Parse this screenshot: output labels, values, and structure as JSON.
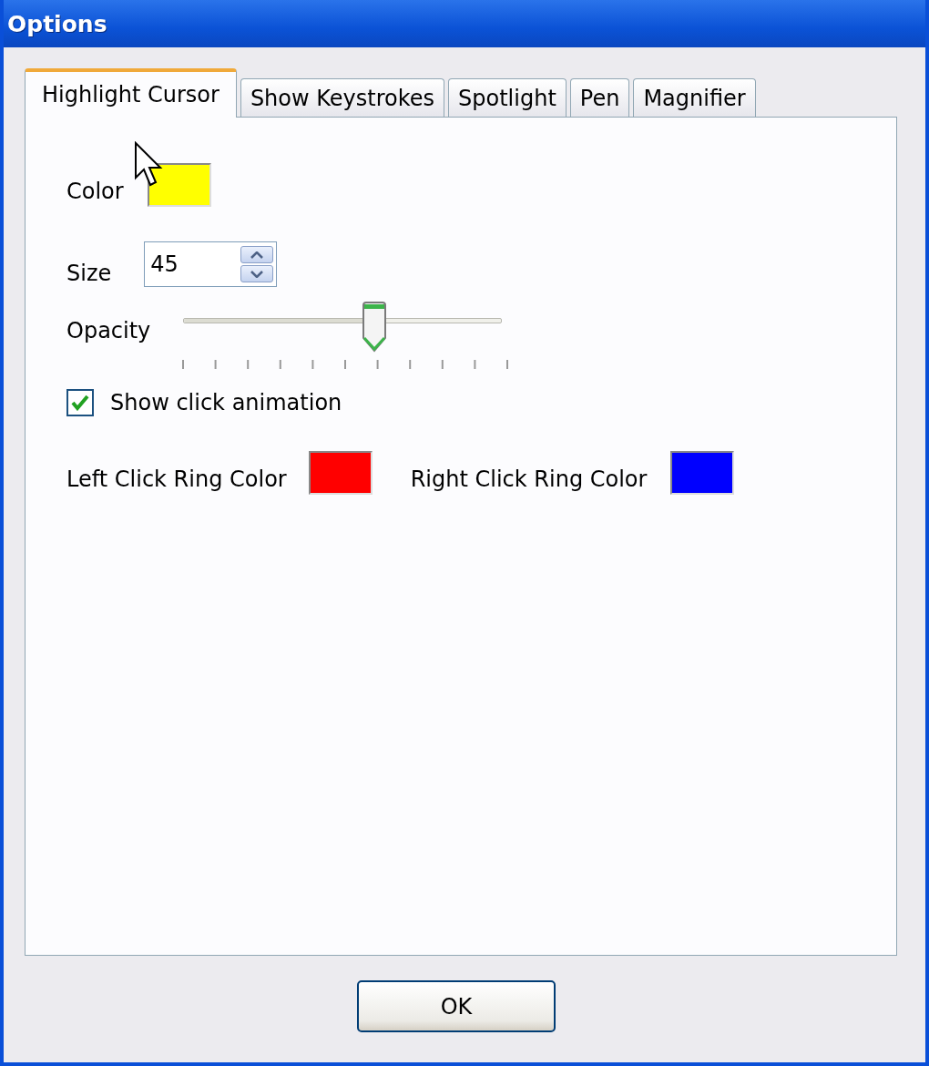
{
  "window": {
    "title": "Options"
  },
  "tabs": [
    {
      "label": "Highlight Cursor",
      "selected": true
    },
    {
      "label": "Show Keystrokes",
      "selected": false
    },
    {
      "label": "Spotlight",
      "selected": false
    },
    {
      "label": "Pen",
      "selected": false
    },
    {
      "label": "Magnifier",
      "selected": false
    }
  ],
  "settings": {
    "color": {
      "label": "Color",
      "color": "#ffff00"
    },
    "size": {
      "label": "Size",
      "value": "45"
    },
    "opacity": {
      "label": "Opacity",
      "level": 0.6
    },
    "click_animation": {
      "label": "Show click animation",
      "checked": true
    },
    "left_ring": {
      "label": "Left Click Ring Color",
      "color": "#ff0000"
    },
    "right_ring": {
      "label": "Right Click Ring Color",
      "color": "#0000ff"
    }
  },
  "buttons": [
    {
      "label": "OK"
    }
  ]
}
